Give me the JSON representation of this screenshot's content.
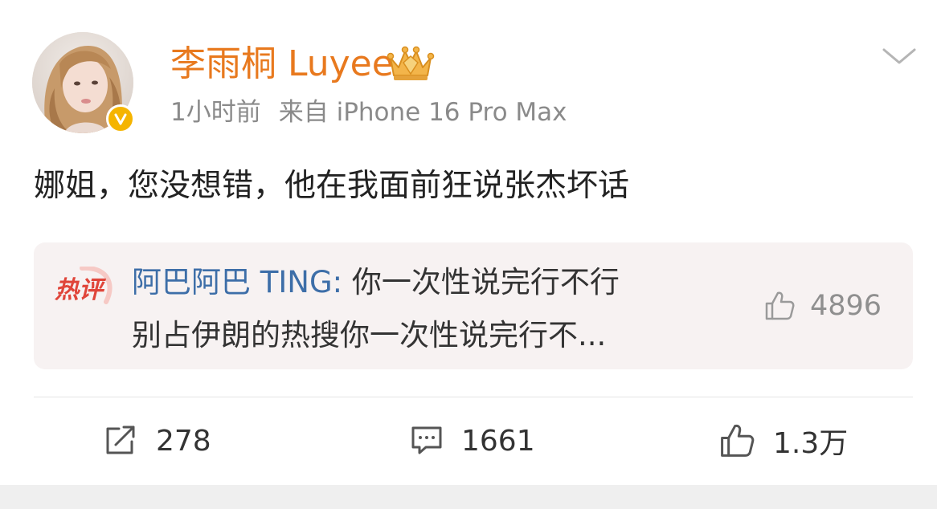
{
  "post": {
    "author": {
      "name": "李雨桐 Luyee",
      "verified": true,
      "name_color": "#e8791e",
      "badge_color": "#f5b400"
    },
    "time": "1小时前",
    "source": "来自 iPhone 16 Pro Max",
    "text": "娜姐，您没想错，他在我面前狂说张杰坏话"
  },
  "hot_comment": {
    "tag": "热评",
    "commenter": "阿巴阿巴 TING:",
    "line1_text": " 你一次性说完行不行",
    "line2_text": "别占伊朗的热搜你一次性说完行不...",
    "likes": "4896",
    "tag_color": "#e0453a",
    "commenter_color": "#3d6ea8"
  },
  "actions": {
    "repost_count": "278",
    "comment_count": "1661",
    "like_count": "1.3万"
  },
  "icons": {
    "avatar": "avatar",
    "badge": "verified-v-icon",
    "crown": "crown-icon",
    "chevron": "chevron-down-icon",
    "repost": "repost-icon",
    "comment": "comment-icon",
    "like": "thumbs-up-icon"
  }
}
